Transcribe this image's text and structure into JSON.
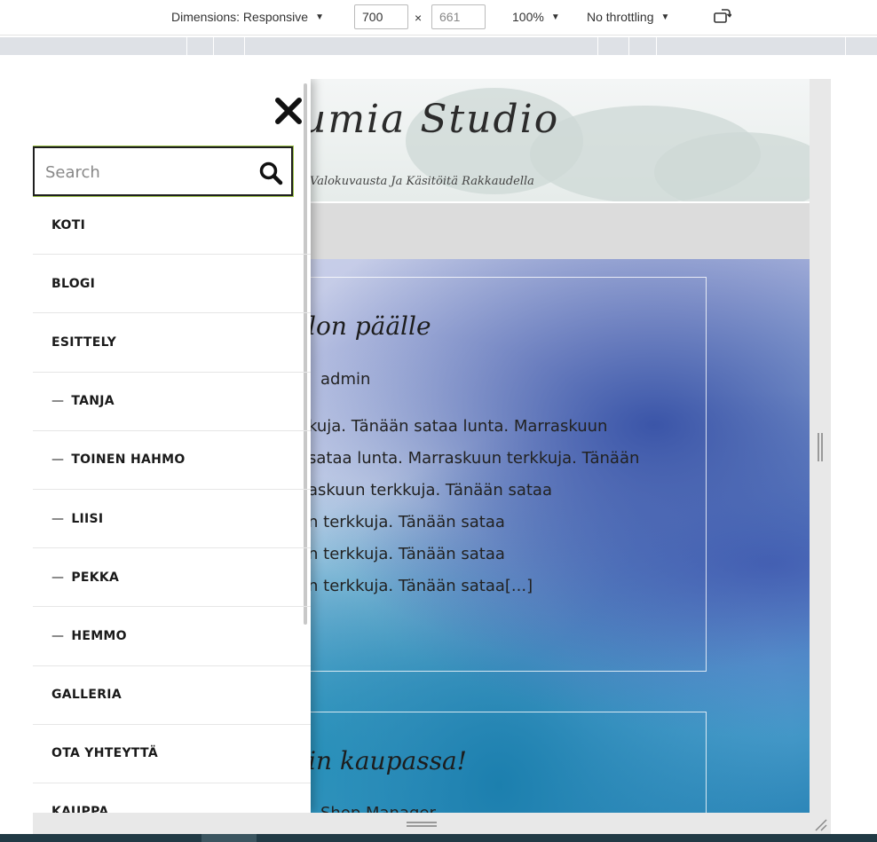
{
  "devtools": {
    "dimensions_label": "Dimensions: Responsive",
    "width_value": "700",
    "height_value": "661",
    "times_sign": "×",
    "zoom": "100%",
    "throttling": "No throttling",
    "rotate_icon": "rotate-icon"
  },
  "site": {
    "title": "umia Studio",
    "tagline": "Valokuvausta Ja Käsitöitä Rakkaudella"
  },
  "menu": {
    "close_icon": "close-icon",
    "search": {
      "placeholder": "Search",
      "icon": "search-icon"
    },
    "items": [
      {
        "label": "KOTI",
        "sub": false
      },
      {
        "label": "BLOGI",
        "sub": false
      },
      {
        "label": "ESITTELY",
        "sub": false
      },
      {
        "label": "TANJA",
        "sub": true
      },
      {
        "label": "TOINEN HAHMO",
        "sub": true
      },
      {
        "label": "LIISI",
        "sub": true
      },
      {
        "label": "PEKKA",
        "sub": true
      },
      {
        "label": "HEMMO",
        "sub": true
      },
      {
        "label": "GALLERIA",
        "sub": false
      },
      {
        "label": "OTA YHTEYTTÄ",
        "sub": false
      },
      {
        "label": "KAUPPA",
        "sub": false
      }
    ],
    "sub_prefix": "—"
  },
  "posts": [
    {
      "title": "lon päälle",
      "author": "admin",
      "lines": [
        "kuja. Tänään sataa lunta. Marraskuun",
        " sataa lunta. Marraskuun terkkuja. Tänään",
        "askuun terkkuja. Tänään sataa",
        "n terkkuja. Tänään sataa",
        "n terkkuja. Tänään sataa",
        "n terkkuja. Tänään sataa[...]"
      ]
    },
    {
      "title": "in kaupassa!",
      "author": "Shop Manager"
    }
  ]
}
